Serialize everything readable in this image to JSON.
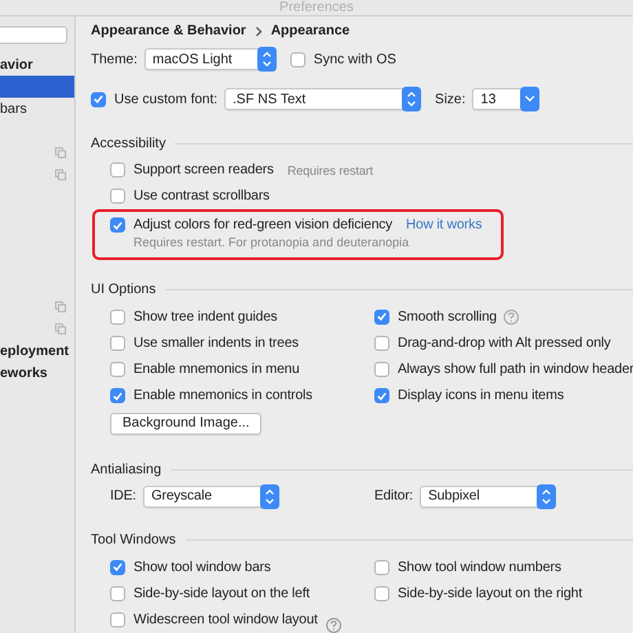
{
  "window": {
    "title": "Preferences"
  },
  "sidebar": {
    "items": [
      {
        "label": "avior",
        "bold": true,
        "selected": false
      },
      {
        "selected": true
      },
      {
        "label": "bars",
        "bold": false,
        "selected": false
      },
      {
        "selected": false
      },
      {
        "selected": false,
        "copy_icon": true
      },
      {
        "selected": false,
        "copy_icon": true
      },
      {
        "selected": false
      },
      {
        "selected": false
      },
      {
        "selected": false
      },
      {
        "selected": false
      },
      {
        "selected": false
      },
      {
        "selected": false,
        "copy_icon": true
      },
      {
        "selected": false,
        "copy_icon": true
      },
      {
        "label": "eployment",
        "bold": true,
        "selected": false
      },
      {
        "label": "eworks",
        "bold": true,
        "selected": false
      }
    ]
  },
  "breadcrumb": [
    "Appearance & Behavior",
    "Appearance"
  ],
  "theme": {
    "label": "Theme:",
    "value": "macOS Light",
    "kind": "stepper"
  },
  "sync_with_os": {
    "label": "Sync with OS",
    "checked": false
  },
  "custom_font": {
    "label": "Use custom font:",
    "checked": true,
    "value": ".SF NS Text",
    "kind": "stepper"
  },
  "size": {
    "label": "Size:",
    "value": "13",
    "kind": "dropdown"
  },
  "sections": [
    {
      "title": "Accessibility",
      "left": [
        {
          "kind": "checkbox",
          "label": "Support screen readers",
          "checked": false,
          "note": "Requires restart"
        },
        {
          "kind": "checkbox",
          "label": "Use contrast scrollbars",
          "checked": false
        },
        {
          "kind": "checkbox",
          "label": "Adjust colors for red-green vision deficiency",
          "checked": true,
          "link": "How it works",
          "note_below": "Requires restart. For protanopia and deuteranopia",
          "highlighted": true
        }
      ]
    },
    {
      "title": "UI Options",
      "left": [
        {
          "kind": "checkbox",
          "label": "Show tree indent guides",
          "checked": false
        },
        {
          "kind": "checkbox",
          "label": "Use smaller indents in trees",
          "checked": false
        },
        {
          "kind": "checkbox",
          "label": "Enable mnemonics in menu",
          "checked": false
        },
        {
          "kind": "checkbox",
          "label": "Enable mnemonics in controls",
          "checked": true
        },
        {
          "kind": "button",
          "label": "Background Image..."
        }
      ],
      "right": [
        {
          "kind": "checkbox",
          "label": "Smooth scrolling",
          "checked": true,
          "help": true
        },
        {
          "kind": "checkbox",
          "label": "Drag-and-drop with Alt pressed only",
          "checked": false
        },
        {
          "kind": "checkbox",
          "label": "Always show full path in window header",
          "checked": false
        },
        {
          "kind": "checkbox",
          "label": "Display icons in menu items",
          "checked": true
        }
      ]
    },
    {
      "title": "Antialiasing",
      "left": [
        {
          "kind": "select",
          "label": "IDE:",
          "value": "Greyscale"
        }
      ],
      "right": [
        {
          "kind": "select",
          "label": "Editor:",
          "value": "Subpixel"
        }
      ]
    },
    {
      "title": "Tool Windows",
      "left": [
        {
          "kind": "checkbox",
          "label": "Show tool window bars",
          "checked": true
        },
        {
          "kind": "checkbox",
          "label": "Side-by-side layout on the left",
          "checked": false
        },
        {
          "kind": "checkbox",
          "label": "Widescreen tool window layout",
          "checked": false
        }
      ],
      "right": [
        {
          "kind": "checkbox",
          "label": "Show tool window numbers",
          "checked": false
        },
        {
          "kind": "checkbox",
          "label": "Side-by-side layout on the right",
          "checked": false
        }
      ]
    }
  ],
  "footer": {
    "help_icon": true
  }
}
